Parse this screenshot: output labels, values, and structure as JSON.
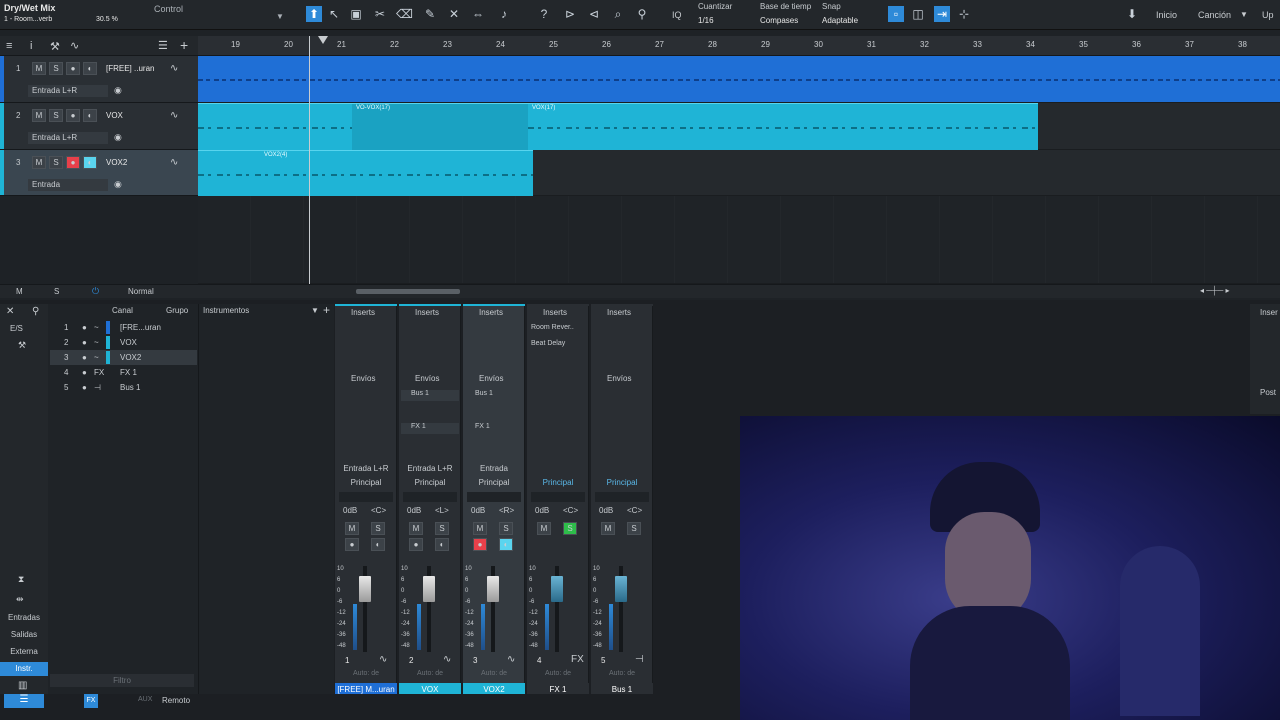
{
  "topbar": {
    "song_title": "Dry/Wet Mix",
    "preset": "1 - Room...verb",
    "zoom_pct": "30.5 %",
    "control_label": "Control",
    "quantize_label": "Cuantizar",
    "quantize_value": "1/16",
    "timebase_label": "Base de tiemp",
    "timebase_value": "Compases",
    "snap_label": "Snap",
    "snap_value": "Adaptable",
    "iq_label": "IQ",
    "nav_inicio": "Inicio",
    "nav_cancion": "Canción",
    "nav_up": "Up"
  },
  "ruler": [
    "19",
    "20",
    "21",
    "22",
    "23",
    "24",
    "25",
    "26",
    "27",
    "28",
    "29",
    "30",
    "31",
    "32",
    "33",
    "34",
    "35",
    "36",
    "37",
    "38"
  ],
  "tracks": [
    {
      "num": "1",
      "m": "M",
      "s": "S",
      "name": "[FREE] ..uran",
      "input": "Entrada L+R"
    },
    {
      "num": "2",
      "m": "M",
      "s": "S",
      "name": "VOX",
      "input": "Entrada L+R"
    },
    {
      "num": "3",
      "m": "M",
      "s": "S",
      "name": "VOX2",
      "input": "Entrada"
    }
  ],
  "clips": {
    "vox_a": "VO-VOX(17)",
    "vox_b": "VOX(17)",
    "vox2": "VOX2(4)"
  },
  "track_footer": {
    "m": "M",
    "s": "S",
    "mode": "Normal"
  },
  "console": {
    "io_label": "E/S",
    "canal_header": "Canal",
    "grupo_header": "Grupo",
    "instruments_header": "Instrumentos",
    "channel_list": [
      {
        "num": "1",
        "type": "~",
        "name": "[FRE...uran"
      },
      {
        "num": "2",
        "type": "~",
        "name": "VOX"
      },
      {
        "num": "3",
        "type": "~",
        "name": "VOX2"
      },
      {
        "num": "4",
        "type": "FX",
        "name": "FX 1"
      },
      {
        "num": "5",
        "type": "⊣",
        "name": "Bus 1"
      }
    ],
    "side_buttons": [
      "Entradas",
      "Salidas",
      "Externa",
      "Instr."
    ],
    "filter_placeholder": "Filtro",
    "bottom": {
      "aux": "AUX",
      "remote": "Remoto"
    },
    "inserts_label": "Inserts",
    "sends_label": "Envíos",
    "fx_inserts": [
      "Room Rever..",
      "Beat Delay"
    ],
    "sends": [
      "Bus 1",
      "FX 1"
    ],
    "right_labels": [
      "Inser",
      "Post"
    ],
    "strips": [
      {
        "io_top": "Entrada L+R",
        "io_bottom": "Principal",
        "db": "0dB",
        "pan": "<C>",
        "m": "M",
        "s": "S",
        "num": "1",
        "auto": "Auto: de",
        "name": "[FREE] M...uran",
        "color": "#1f6fd6"
      },
      {
        "io_top": "Entrada L+R",
        "io_bottom": "Principal",
        "db": "0dB",
        "pan": "<L>",
        "m": "M",
        "s": "S",
        "num": "2",
        "auto": "Auto: de",
        "name": "VOX",
        "color": "#1fb4d6"
      },
      {
        "io_top": "Entrada",
        "io_bottom": "Principal",
        "db": "0dB",
        "pan": "<R>",
        "m": "M",
        "s": "S",
        "num": "3",
        "auto": "Auto: de",
        "name": "VOX2",
        "color": "#1fb4d6"
      },
      {
        "io_top": "",
        "io_bottom": "Principal",
        "db": "0dB",
        "pan": "<C>",
        "m": "M",
        "s": "S",
        "num": "4",
        "auto": "Auto: de",
        "name": "FX 1",
        "color": "#2a2e33",
        "type": "FX"
      },
      {
        "io_top": "",
        "io_bottom": "Principal",
        "db": "0dB",
        "pan": "<C>",
        "m": "M",
        "s": "S",
        "num": "5",
        "auto": "Auto: de",
        "name": "Bus 1",
        "color": "#2a2e33",
        "type": "⊣"
      }
    ],
    "scale": [
      "10",
      "6",
      "0",
      "-6",
      "-12",
      "-24",
      "-36",
      "-48"
    ]
  }
}
